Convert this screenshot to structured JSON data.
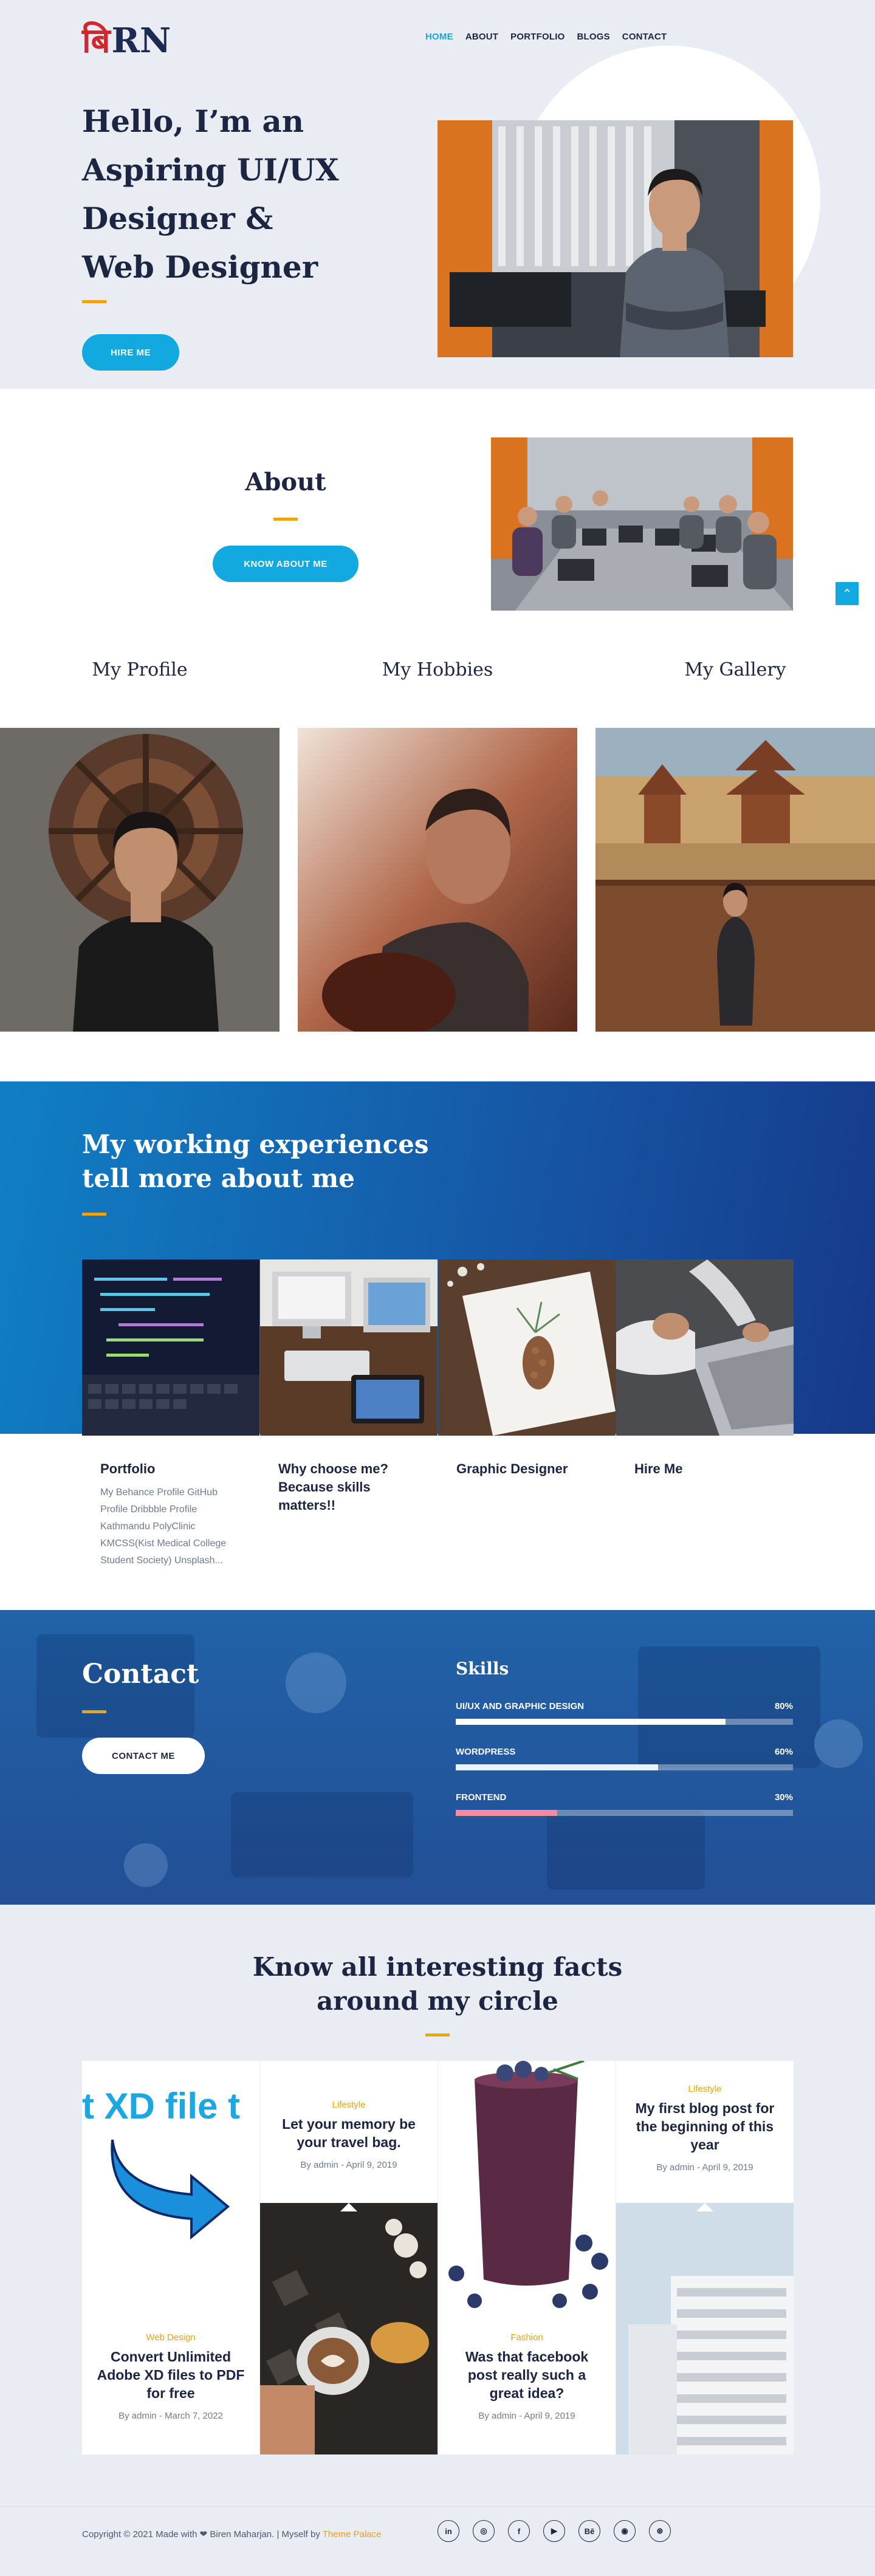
{
  "header": {
    "logo_text_red": "बि",
    "logo_text_navy": "RN",
    "nav": [
      "HOME",
      "ABOUT",
      "PORTFOLIO",
      "BLOGS",
      "CONTACT"
    ],
    "active_nav": "HOME"
  },
  "hero": {
    "title": "Hello, I’m an Aspiring UI/UX Designer & Web Designer",
    "button": "HIRE ME"
  },
  "about": {
    "title": "About",
    "button": "KNOW ABOUT ME",
    "scroll_top_icon": "chevron-up-icon",
    "tabs": [
      "My Profile",
      "My Hobbies",
      "My Gallery"
    ]
  },
  "experience": {
    "title_line1": "My working experiences",
    "title_line2": "tell more about me",
    "cards": [
      {
        "title": "Portfolio",
        "desc": "My Behance Profile GitHub Profile Dribbble Profile Kathmandu PolyClinic KMCSS(Kist Medical College Student Society) Unsplash..."
      },
      {
        "title": "Why choose me? Because skills matters!!",
        "desc": ""
      },
      {
        "title": "Graphic Designer",
        "desc": ""
      },
      {
        "title": "Hire Me",
        "desc": ""
      }
    ]
  },
  "contact": {
    "title": "Contact",
    "button": "CONTACT ME",
    "skills_title": "Skills",
    "skills": [
      {
        "name": "UI/UX AND GRAPHIC DESIGN",
        "percent_label": "80%",
        "value": 80,
        "color": "#ffffff"
      },
      {
        "name": "WORDPRESS",
        "percent_label": "60%",
        "value": 60,
        "color": "#e8f4fb"
      },
      {
        "name": "FRONTEND",
        "percent_label": "30%",
        "value": 30,
        "color": "#f58ba1"
      }
    ]
  },
  "facts": {
    "title_line1": "Know all interesting facts",
    "title_line2": "around my circle",
    "posts": [
      {
        "category": "Web Design",
        "title": "Convert Unlimited Adobe XD files to PDF for free",
        "meta": "By admin - March 7, 2022",
        "image_text": "t XD file t"
      },
      {
        "category": "Lifestyle",
        "title": "Let your memory be your travel bag.",
        "meta": "By admin - April 9, 2019"
      },
      {
        "category": "Fashion",
        "title": "Was that facebook post really such a great idea?",
        "meta": "By admin - April 9, 2019"
      },
      {
        "category": "Lifestyle",
        "title": "My first blog post for the beginning of this year",
        "meta": "By admin - April 9, 2019"
      }
    ]
  },
  "footer": {
    "copyright": "Copyright © 2021 Made with ❤ Biren Maharjan. | Myself by",
    "theme_link": "Theme Palace",
    "socials": [
      {
        "icon": "linkedin-icon",
        "glyph": "in"
      },
      {
        "icon": "github-icon",
        "glyph": "◎"
      },
      {
        "icon": "facebook-icon",
        "glyph": "f"
      },
      {
        "icon": "youtube-icon",
        "glyph": "▶"
      },
      {
        "icon": "behance-icon",
        "glyph": "Bē"
      },
      {
        "icon": "instagram-icon",
        "glyph": "◉"
      },
      {
        "icon": "dribbble-icon",
        "glyph": "⊛"
      }
    ]
  }
}
